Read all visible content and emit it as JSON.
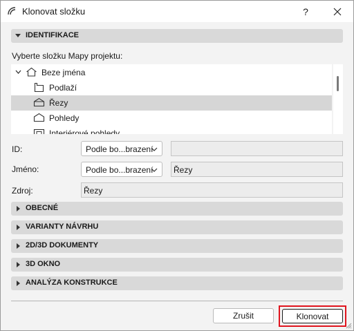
{
  "window": {
    "title": "Klonovat složku",
    "help_label": "?"
  },
  "identification": {
    "section_label": "IDENTIFIKACE",
    "tree_label": "Vyberte složku Mapy projektu:",
    "tree_items": [
      {
        "label": "Beze jména",
        "icon": "home-icon",
        "expanded": true
      },
      {
        "label": "Podlaží",
        "icon": "floor-icon"
      },
      {
        "label": "Řezy",
        "icon": "section-icon",
        "selected": true
      },
      {
        "label": "Pohledy",
        "icon": "elevation-icon"
      },
      {
        "label": "Interiérové pohledy",
        "icon": "interior-icon"
      }
    ],
    "id_label": "ID:",
    "id_select": "Podle bo...brazení",
    "id_value": "",
    "name_label": "Jméno:",
    "name_select": "Podle bo...brazení",
    "name_value": "Řezy",
    "source_label": "Zdroj:",
    "source_value": "Řezy"
  },
  "sections": [
    "OBECNÉ",
    "VARIANTY NÁVRHU",
    "2D/3D DOKUMENTY",
    "3D OKNO",
    "ANALÝZA KONSTRUKCE"
  ],
  "buttons": {
    "cancel": "Zrušit",
    "clone": "Klonovat"
  },
  "colors": {
    "highlight_border": "#e0141e",
    "selection": "#d6d6d6",
    "section_bg": "#d9d9d9"
  }
}
